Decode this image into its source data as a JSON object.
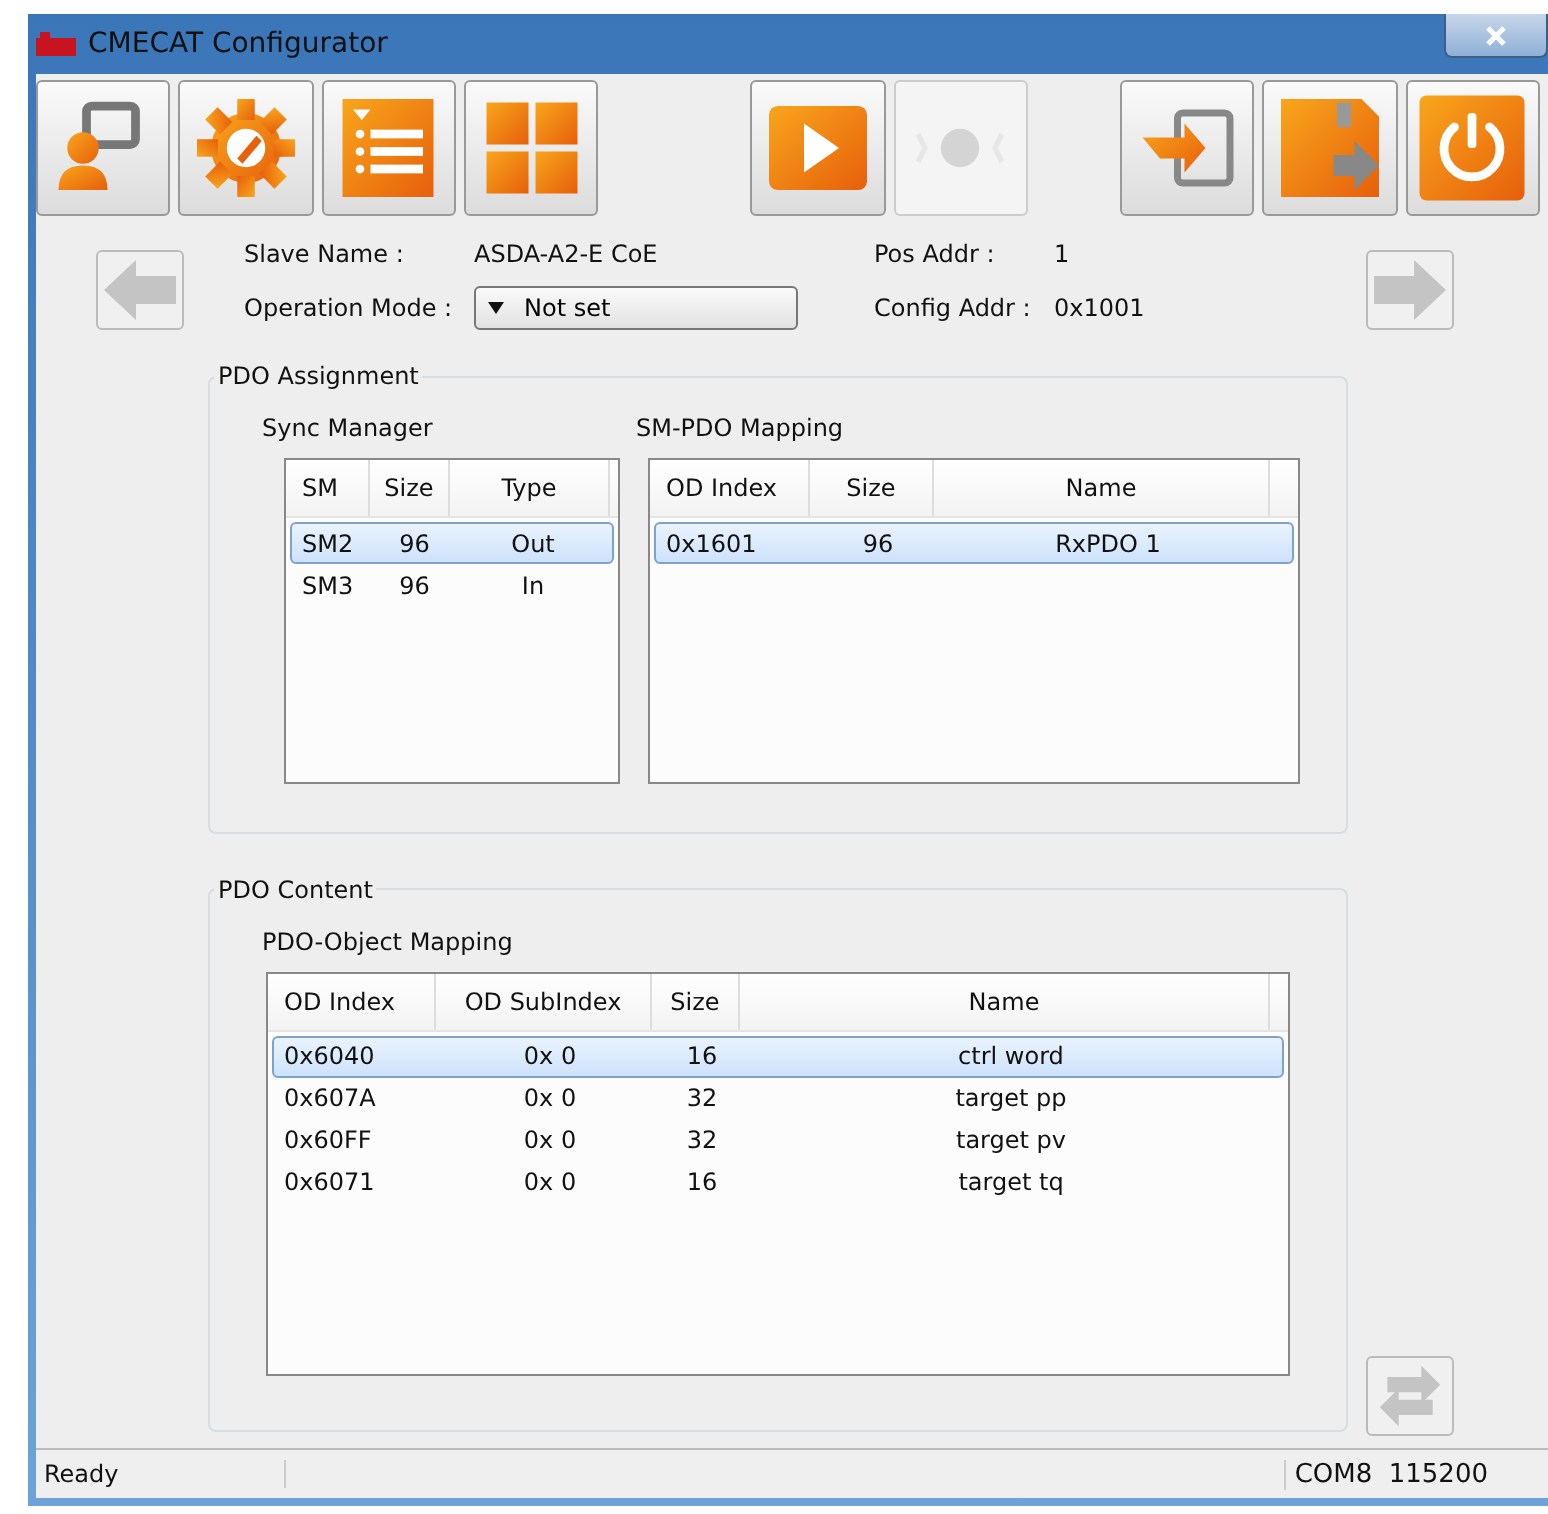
{
  "window": {
    "title": "CMECAT Configurator"
  },
  "toolbar": [
    {
      "kind": "connect",
      "disabled": false
    },
    {
      "kind": "settings",
      "disabled": false
    },
    {
      "kind": "list",
      "disabled": false
    },
    {
      "kind": "grid",
      "disabled": false
    },
    {
      "kind": "play",
      "disabled": false
    },
    {
      "kind": "record",
      "disabled": true
    },
    {
      "kind": "import",
      "disabled": false
    },
    {
      "kind": "save",
      "disabled": false
    },
    {
      "kind": "power",
      "disabled": false
    }
  ],
  "navigation": {
    "previous": {
      "disabled": true
    },
    "next": {
      "disabled": true
    }
  },
  "slave": {
    "name_label": "Slave Name :",
    "name": "ASDA-A2-E CoE",
    "mode_label": "Operation Mode :",
    "mode": "Not set",
    "pos_addr_label": "Pos Addr :",
    "pos_addr": "1",
    "config_addr_label": "Config Addr :",
    "config_addr": "0x1001"
  },
  "pdo_assignment": {
    "title": "PDO Assignment",
    "sync_manager": {
      "title": "Sync Manager",
      "columns": [
        "SM",
        "Size",
        "Type"
      ],
      "rows": [
        {
          "cells": [
            "SM2",
            "96",
            "Out"
          ],
          "selected": true
        },
        {
          "cells": [
            "SM3",
            "96",
            "In"
          ],
          "selected": false
        }
      ]
    },
    "sm_pdo_mapping": {
      "title": "SM-PDO Mapping",
      "columns": [
        "OD Index",
        "Size",
        "Name"
      ],
      "rows": [
        {
          "cells": [
            "0x1601",
            "96",
            "RxPDO 1"
          ],
          "selected": true
        }
      ]
    }
  },
  "pdo_content": {
    "title": "PDO Content",
    "object_mapping": {
      "title": "PDO-Object Mapping",
      "columns": [
        "OD Index",
        "OD SubIndex",
        "Size",
        "Name"
      ],
      "rows": [
        {
          "cells": [
            "0x6040",
            "0x 0",
            "16",
            "ctrl word"
          ],
          "selected": true
        },
        {
          "cells": [
            "0x607A",
            "0x 0",
            "32",
            "target pp"
          ],
          "selected": false
        },
        {
          "cells": [
            "0x60FF",
            "0x 0",
            "32",
            "target pv"
          ],
          "selected": false
        },
        {
          "cells": [
            "0x6071",
            "0x 0",
            "16",
            "target tq"
          ],
          "selected": false
        }
      ]
    }
  },
  "restore_button": {
    "disabled": true
  },
  "status_bar": {
    "message": "Ready",
    "port": "COM8  115200"
  }
}
